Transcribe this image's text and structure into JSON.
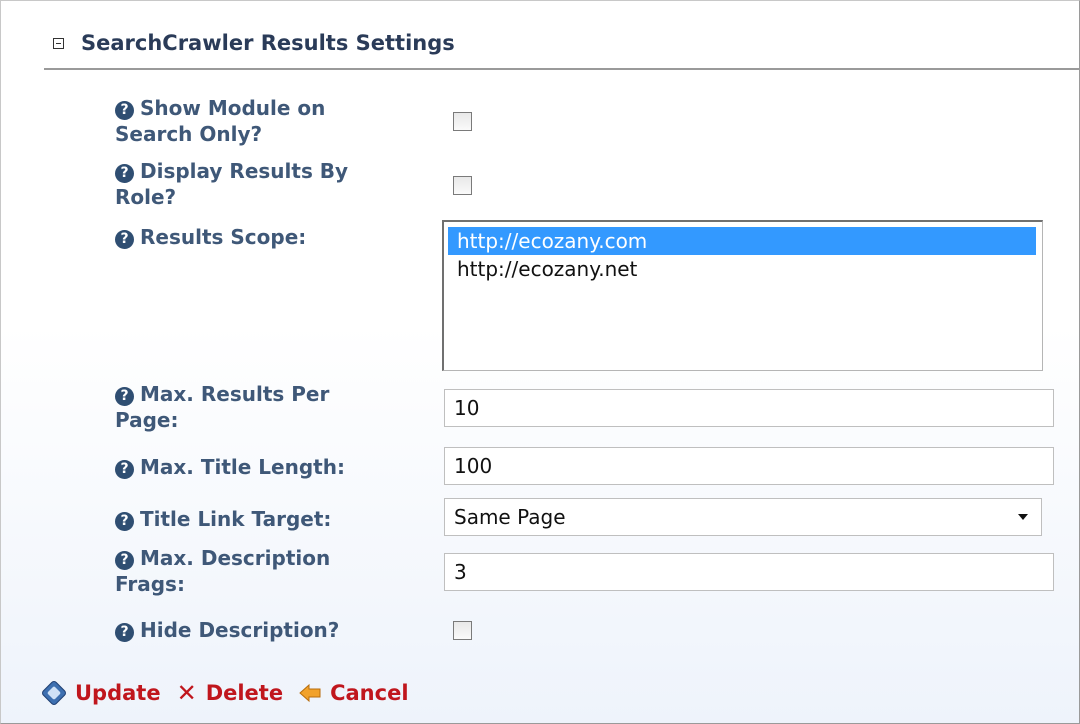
{
  "section": {
    "title": "SearchCrawler Results Settings"
  },
  "help_glyph": "?",
  "fields": {
    "show_module": {
      "label_line1": "Show Module on",
      "label_line2": "Search Only?",
      "checked": false
    },
    "display_by_role": {
      "label_line1": "Display Results By",
      "label_line2": "Role?",
      "checked": false
    },
    "results_scope": {
      "label": "Results Scope:",
      "options": [
        "http://ecozany.com",
        "http://ecozany.net"
      ],
      "selected": "http://ecozany.com"
    },
    "max_results": {
      "label_line1": "Max. Results Per",
      "label_line2": "Page:",
      "value": "10"
    },
    "max_title": {
      "label": "Max. Title Length:",
      "value": "100"
    },
    "title_link_target": {
      "label": "Title Link Target:",
      "value": "Same Page"
    },
    "max_desc_frags": {
      "label_line1": "Max. Description",
      "label_line2": "Frags:",
      "value": "3"
    },
    "hide_description": {
      "label": "Hide Description?",
      "checked": false
    }
  },
  "actions": {
    "update": "Update",
    "delete": "Delete",
    "cancel": "Cancel"
  },
  "icons": [
    "collapse-icon",
    "help-icon",
    "update-icon",
    "delete-icon",
    "cancel-icon"
  ],
  "colors": {
    "label": "#3f5878",
    "selected": "#3399ff",
    "action": "#c0161d"
  }
}
